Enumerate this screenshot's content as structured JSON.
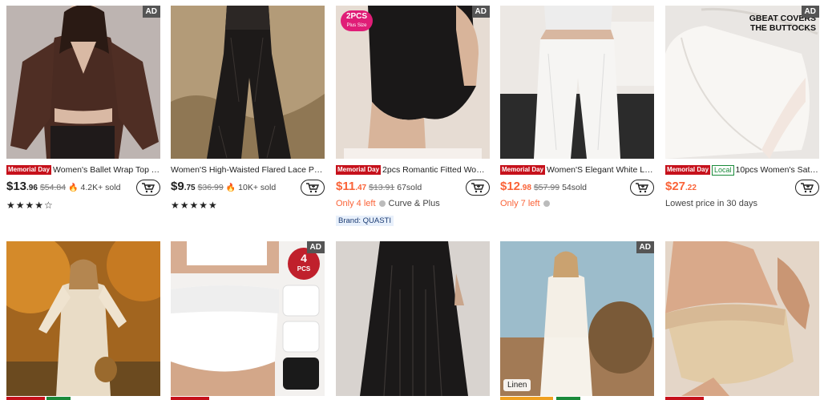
{
  "row1": [
    {
      "ad": "AD",
      "badge": "Memorial Day",
      "title": "Women's Ballet Wrap Top Y...",
      "price_main": "$13",
      "price_cents": ".96",
      "original": "$54.84",
      "sold": "4.2K+ sold",
      "rating": "★★★★☆"
    },
    {
      "title": "Women'S High-Waisted Flared Lace Pa...",
      "price_main": "$9",
      "price_cents": ".75",
      "original": "$36.99",
      "sold": "10K+ sold",
      "rating": "★★★★★"
    },
    {
      "ad": "AD",
      "pack": "2PCS",
      "pack_sub": "Plus Size",
      "badge": "Memorial Day",
      "title": "2pcs Romantic Fitted Wome...",
      "price_main": "$11",
      "price_cents": ".47",
      "original": "$13.91",
      "sold": "67sold",
      "stock": "Only 4 left",
      "category": "Curve & Plus",
      "brand": "Brand: QUASTI"
    },
    {
      "badge": "Memorial Day",
      "title": "Women'S Elegant White Lac...",
      "price_main": "$12",
      "price_cents": ".98",
      "original": "$57.99",
      "sold": "54sold",
      "stock": "Only 7 left"
    },
    {
      "ad": "AD",
      "overlay": "GBEAT COVERS THE BUTTOCKS",
      "badge": "Memorial Day",
      "local": "Local",
      "title": "10pcs Women's Satin...",
      "price_main": "$27",
      "price_cents": ".22",
      "note": "Lowest price in 30 days"
    }
  ],
  "row2": [
    {},
    {
      "ad": "AD",
      "pcs_num": "4",
      "pcs_label": "PCS"
    },
    {},
    {
      "ad": "AD",
      "tag": "Linen"
    },
    {}
  ],
  "icons": {
    "cart": "cart-add-icon",
    "flame": "flame-icon",
    "info": "info-icon"
  },
  "colors": {
    "promo_red": "#c6111b",
    "price_orange": "#fa6338",
    "local_green": "#1a8a3a"
  }
}
